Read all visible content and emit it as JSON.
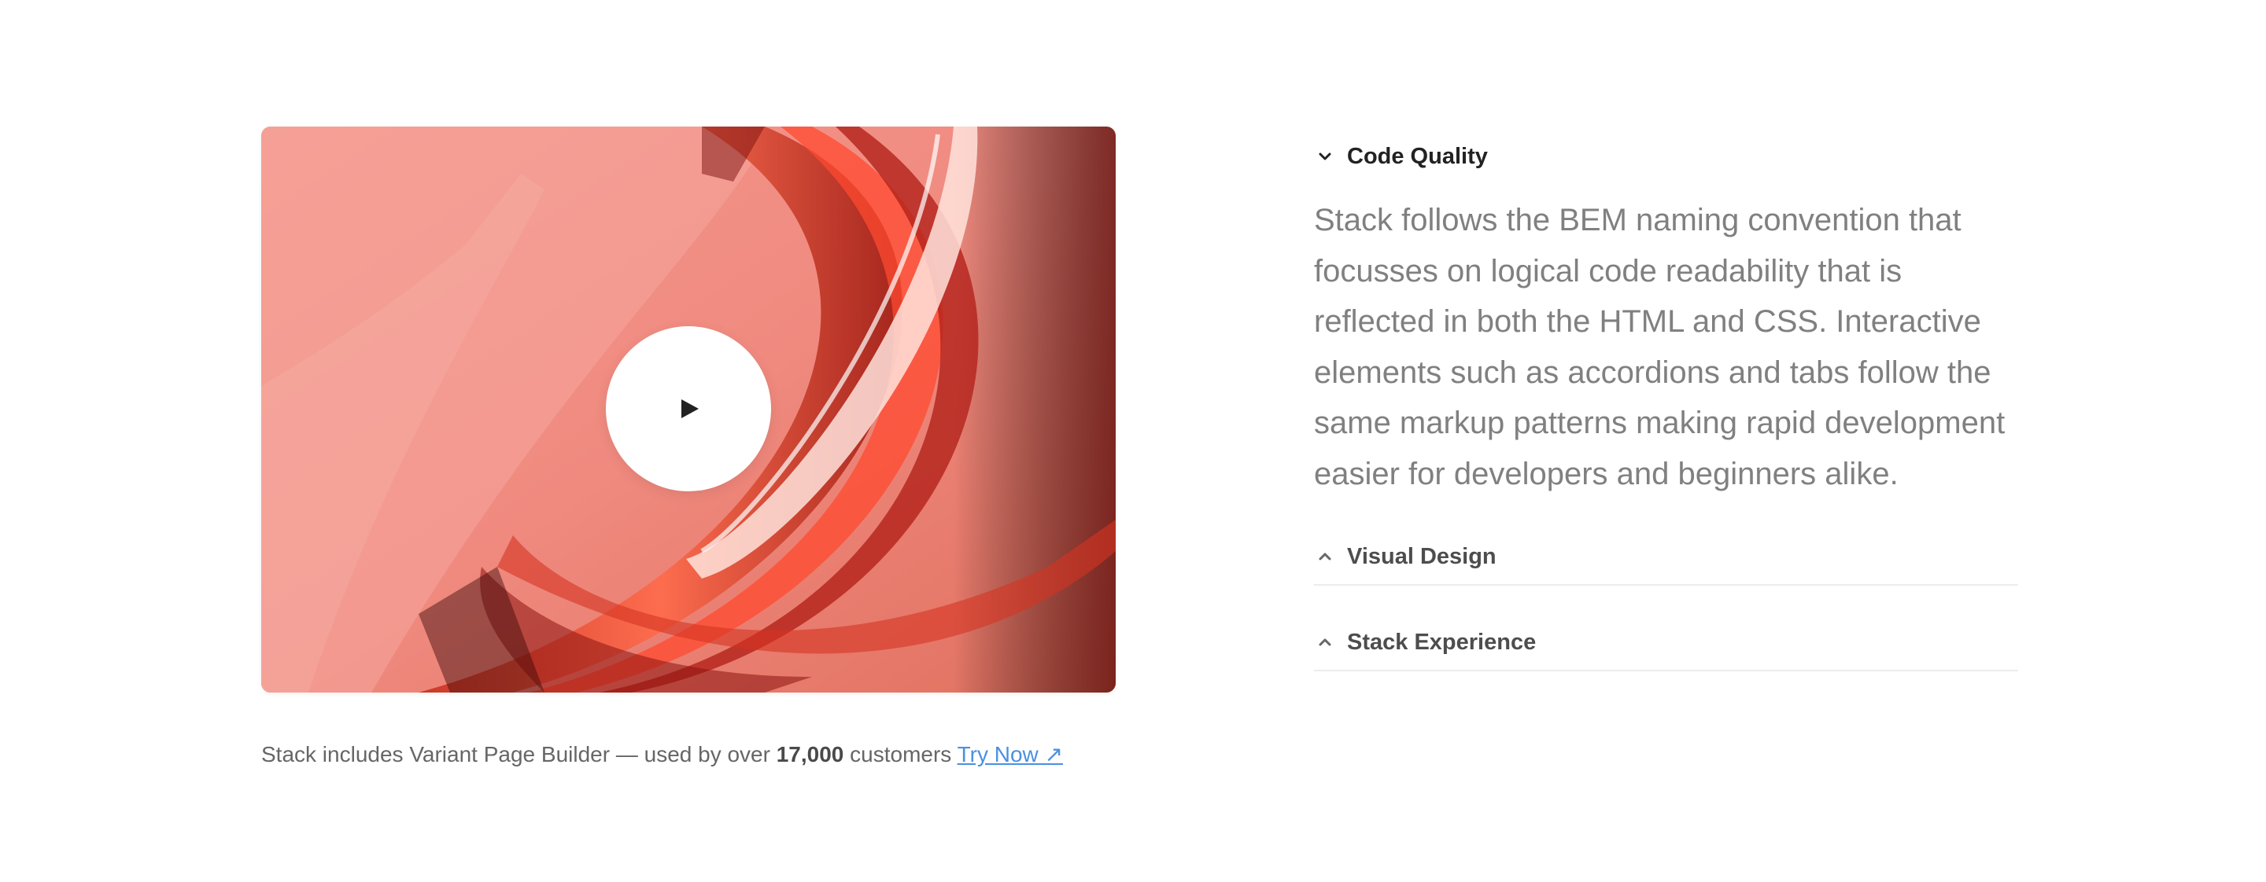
{
  "media": {
    "play_icon": "play-icon"
  },
  "caption": {
    "text_before": "Stack includes Variant Page Builder — used by over ",
    "count": "17,000",
    "text_after": " customers ",
    "link_label": "Try Now ↗",
    "link_color": "#4a90e2"
  },
  "accordion": {
    "items": [
      {
        "title": "Code Quality",
        "state": "expanded",
        "icon": "chevron-down-icon",
        "content": "Stack follows the BEM naming convention that focusses on logical code readability that is reflected in both the HTML and CSS. Interactive elements such as accordions and tabs follow the same markup patterns making rapid development easier for developers and beginners alike."
      },
      {
        "title": "Visual Design",
        "state": "collapsed",
        "icon": "chevron-up-icon"
      },
      {
        "title": "Stack Experience",
        "state": "collapsed",
        "icon": "chevron-up-icon"
      }
    ]
  }
}
